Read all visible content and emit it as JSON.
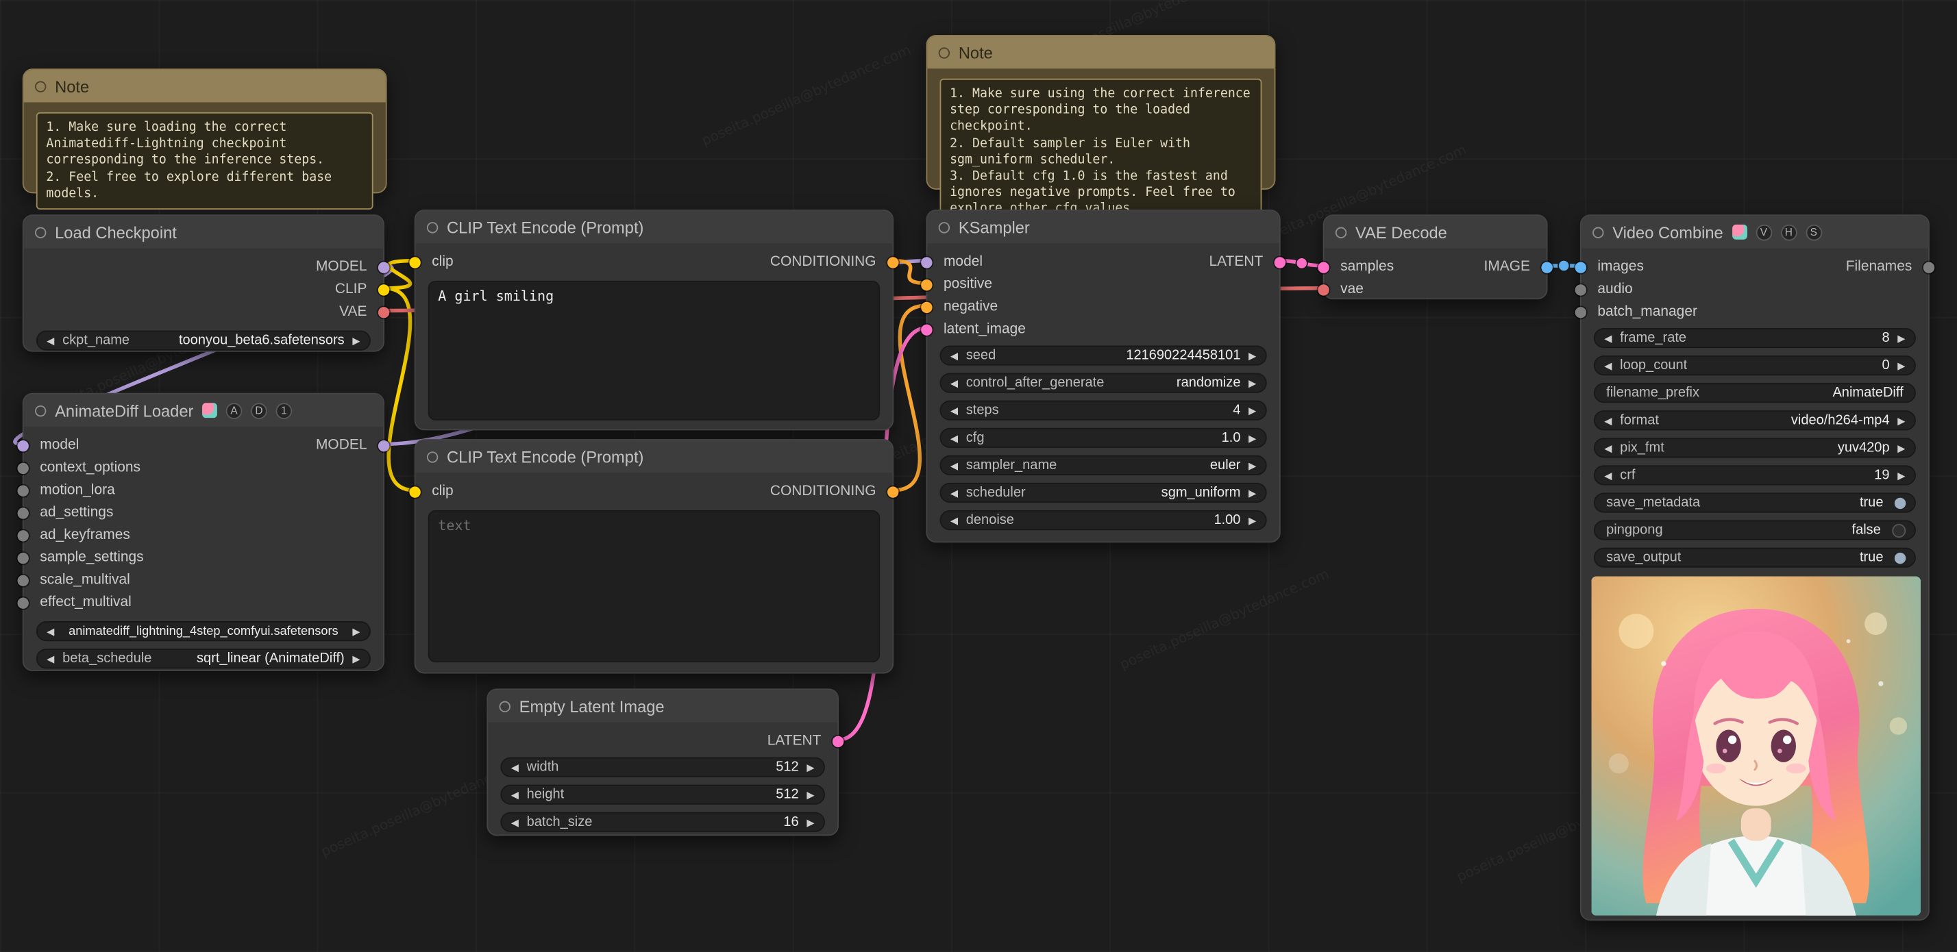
{
  "ui": {
    "arrow_left": "◀",
    "arrow_right": "▶"
  },
  "watermark": "poseita.poseilla@bytedance.com",
  "colors": {
    "model": "#b39ddb",
    "clip": "#ffd500",
    "vae": "#e06c6c",
    "conditioning": "#ffa931",
    "latent": "#ff6ec7",
    "image": "#64b5f6",
    "note_header": "#93815a",
    "node_bg": "#353535",
    "canvas_bg": "#1d1d1d"
  },
  "nodes": {
    "note_left": {
      "title": "Note",
      "body": "1. Make sure loading the correct Animatediff-Lightning checkpoint corresponding to the inference steps.\n2. Feel free to explore different base models."
    },
    "note_top": {
      "title": "Note",
      "body": "1. Make sure using the correct inference step corresponding to the loaded checkpoint.\n2. Default sampler is Euler with sgm_uniform scheduler.\n3. Default cfg 1.0 is the fastest and ignores negative prompts. Feel free to explore other cfg values."
    },
    "load_checkpoint": {
      "title": "Load Checkpoint",
      "outputs": [
        "MODEL",
        "CLIP",
        "VAE"
      ],
      "widgets": [
        {
          "label": "ckpt_name",
          "value": "toonyou_beta6.safetensors"
        }
      ]
    },
    "animatediff_loader": {
      "title": "AnimateDiff Loader",
      "badges": [
        "A",
        "D",
        "1"
      ],
      "inputs": [
        "model",
        "context_options",
        "motion_lora",
        "ad_settings",
        "ad_keyframes",
        "sample_settings",
        "scale_multival",
        "effect_multival"
      ],
      "output": "MODEL",
      "widgets": [
        {
          "value": "animatediff_lightning_4step_comfyui.safetensors"
        },
        {
          "label": "beta_schedule",
          "value": "sqrt_linear (AnimateDiff)"
        }
      ]
    },
    "clip_positive": {
      "title": "CLIP Text Encode (Prompt)",
      "input": "clip",
      "output": "CONDITIONING",
      "text": "A girl smiling"
    },
    "clip_negative": {
      "title": "CLIP Text Encode (Prompt)",
      "input": "clip",
      "output": "CONDITIONING",
      "placeholder": "text"
    },
    "empty_latent": {
      "title": "Empty Latent Image",
      "output": "LATENT",
      "widgets": [
        {
          "label": "width",
          "value": "512"
        },
        {
          "label": "height",
          "value": "512"
        },
        {
          "label": "batch_size",
          "value": "16"
        }
      ]
    },
    "ksampler": {
      "title": "KSampler",
      "inputs": [
        "model",
        "positive",
        "negative",
        "latent_image"
      ],
      "output": "LATENT",
      "widgets": [
        {
          "label": "seed",
          "value": "121690224458101"
        },
        {
          "label": "control_after_generate",
          "value": "randomize"
        },
        {
          "label": "steps",
          "value": "4"
        },
        {
          "label": "cfg",
          "value": "1.0"
        },
        {
          "label": "sampler_name",
          "value": "euler"
        },
        {
          "label": "scheduler",
          "value": "sgm_uniform"
        },
        {
          "label": "denoise",
          "value": "1.00"
        }
      ]
    },
    "vae_decode": {
      "title": "VAE Decode",
      "inputs": [
        "samples",
        "vae"
      ],
      "output": "IMAGE"
    },
    "video_combine": {
      "title": "Video Combine",
      "badges": [
        "V",
        "H",
        "S"
      ],
      "inputs": [
        "images",
        "audio",
        "batch_manager"
      ],
      "output": "Filenames",
      "widgets": [
        {
          "label": "frame_rate",
          "value": "8"
        },
        {
          "label": "loop_count",
          "value": "0"
        },
        {
          "label": "filename_prefix",
          "value": "AnimateDiff"
        },
        {
          "label": "format",
          "value": "video/h264-mp4"
        },
        {
          "label": "pix_fmt",
          "value": "yuv420p"
        },
        {
          "label": "crf",
          "value": "19"
        },
        {
          "label": "save_metadata",
          "value": "true",
          "state": "on"
        },
        {
          "label": "pingpong",
          "value": "false",
          "state": "off"
        },
        {
          "label": "save_output",
          "value": "true",
          "state": "on"
        }
      ]
    }
  }
}
